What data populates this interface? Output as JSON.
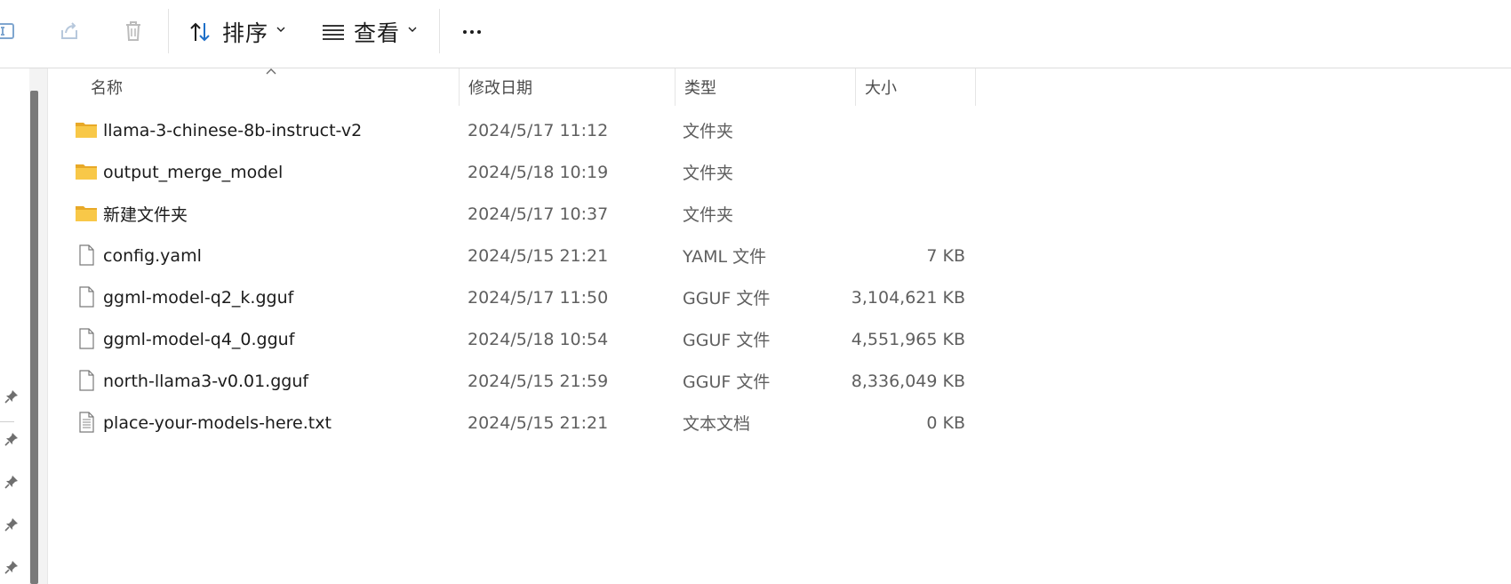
{
  "toolbar": {
    "sort_label": "排序",
    "view_label": "查看",
    "icons": {
      "rename": "rename-icon",
      "share": "share-icon",
      "delete": "delete-icon",
      "sort": "sort-arrows-icon",
      "view": "view-lines-icon",
      "more": "more-dots-icon"
    }
  },
  "columns": {
    "name": "名称",
    "date": "修改日期",
    "type": "类型",
    "size": "大小"
  },
  "files": [
    {
      "name": "llama-3-chinese-8b-instruct-v2",
      "date": "2024/5/17 11:12",
      "type": "文件夹",
      "size": "",
      "icon": "folder"
    },
    {
      "name": "output_merge_model",
      "date": "2024/5/18 10:19",
      "type": "文件夹",
      "size": "",
      "icon": "folder"
    },
    {
      "name": "新建文件夹",
      "date": "2024/5/17 10:37",
      "type": "文件夹",
      "size": "",
      "icon": "folder"
    },
    {
      "name": "config.yaml",
      "date": "2024/5/15 21:21",
      "type": "YAML 文件",
      "size": "7 KB",
      "icon": "file"
    },
    {
      "name": "ggml-model-q2_k.gguf",
      "date": "2024/5/17 11:50",
      "type": "GGUF 文件",
      "size": "3,104,621 KB",
      "icon": "file"
    },
    {
      "name": "ggml-model-q4_0.gguf",
      "date": "2024/5/18 10:54",
      "type": "GGUF 文件",
      "size": "4,551,965 KB",
      "icon": "file"
    },
    {
      "name": "north-llama3-v0.01.gguf",
      "date": "2024/5/15 21:59",
      "type": "GGUF 文件",
      "size": "8,336,049 KB",
      "icon": "file"
    },
    {
      "name": "place-your-models-here.txt",
      "date": "2024/5/15 21:21",
      "type": "文本文档",
      "size": "0 KB",
      "icon": "text-file"
    }
  ],
  "colors": {
    "folder_yellow": "#f8c848",
    "accent_blue": "#1e6fc8",
    "scrollbar": "#7a7a7a"
  }
}
